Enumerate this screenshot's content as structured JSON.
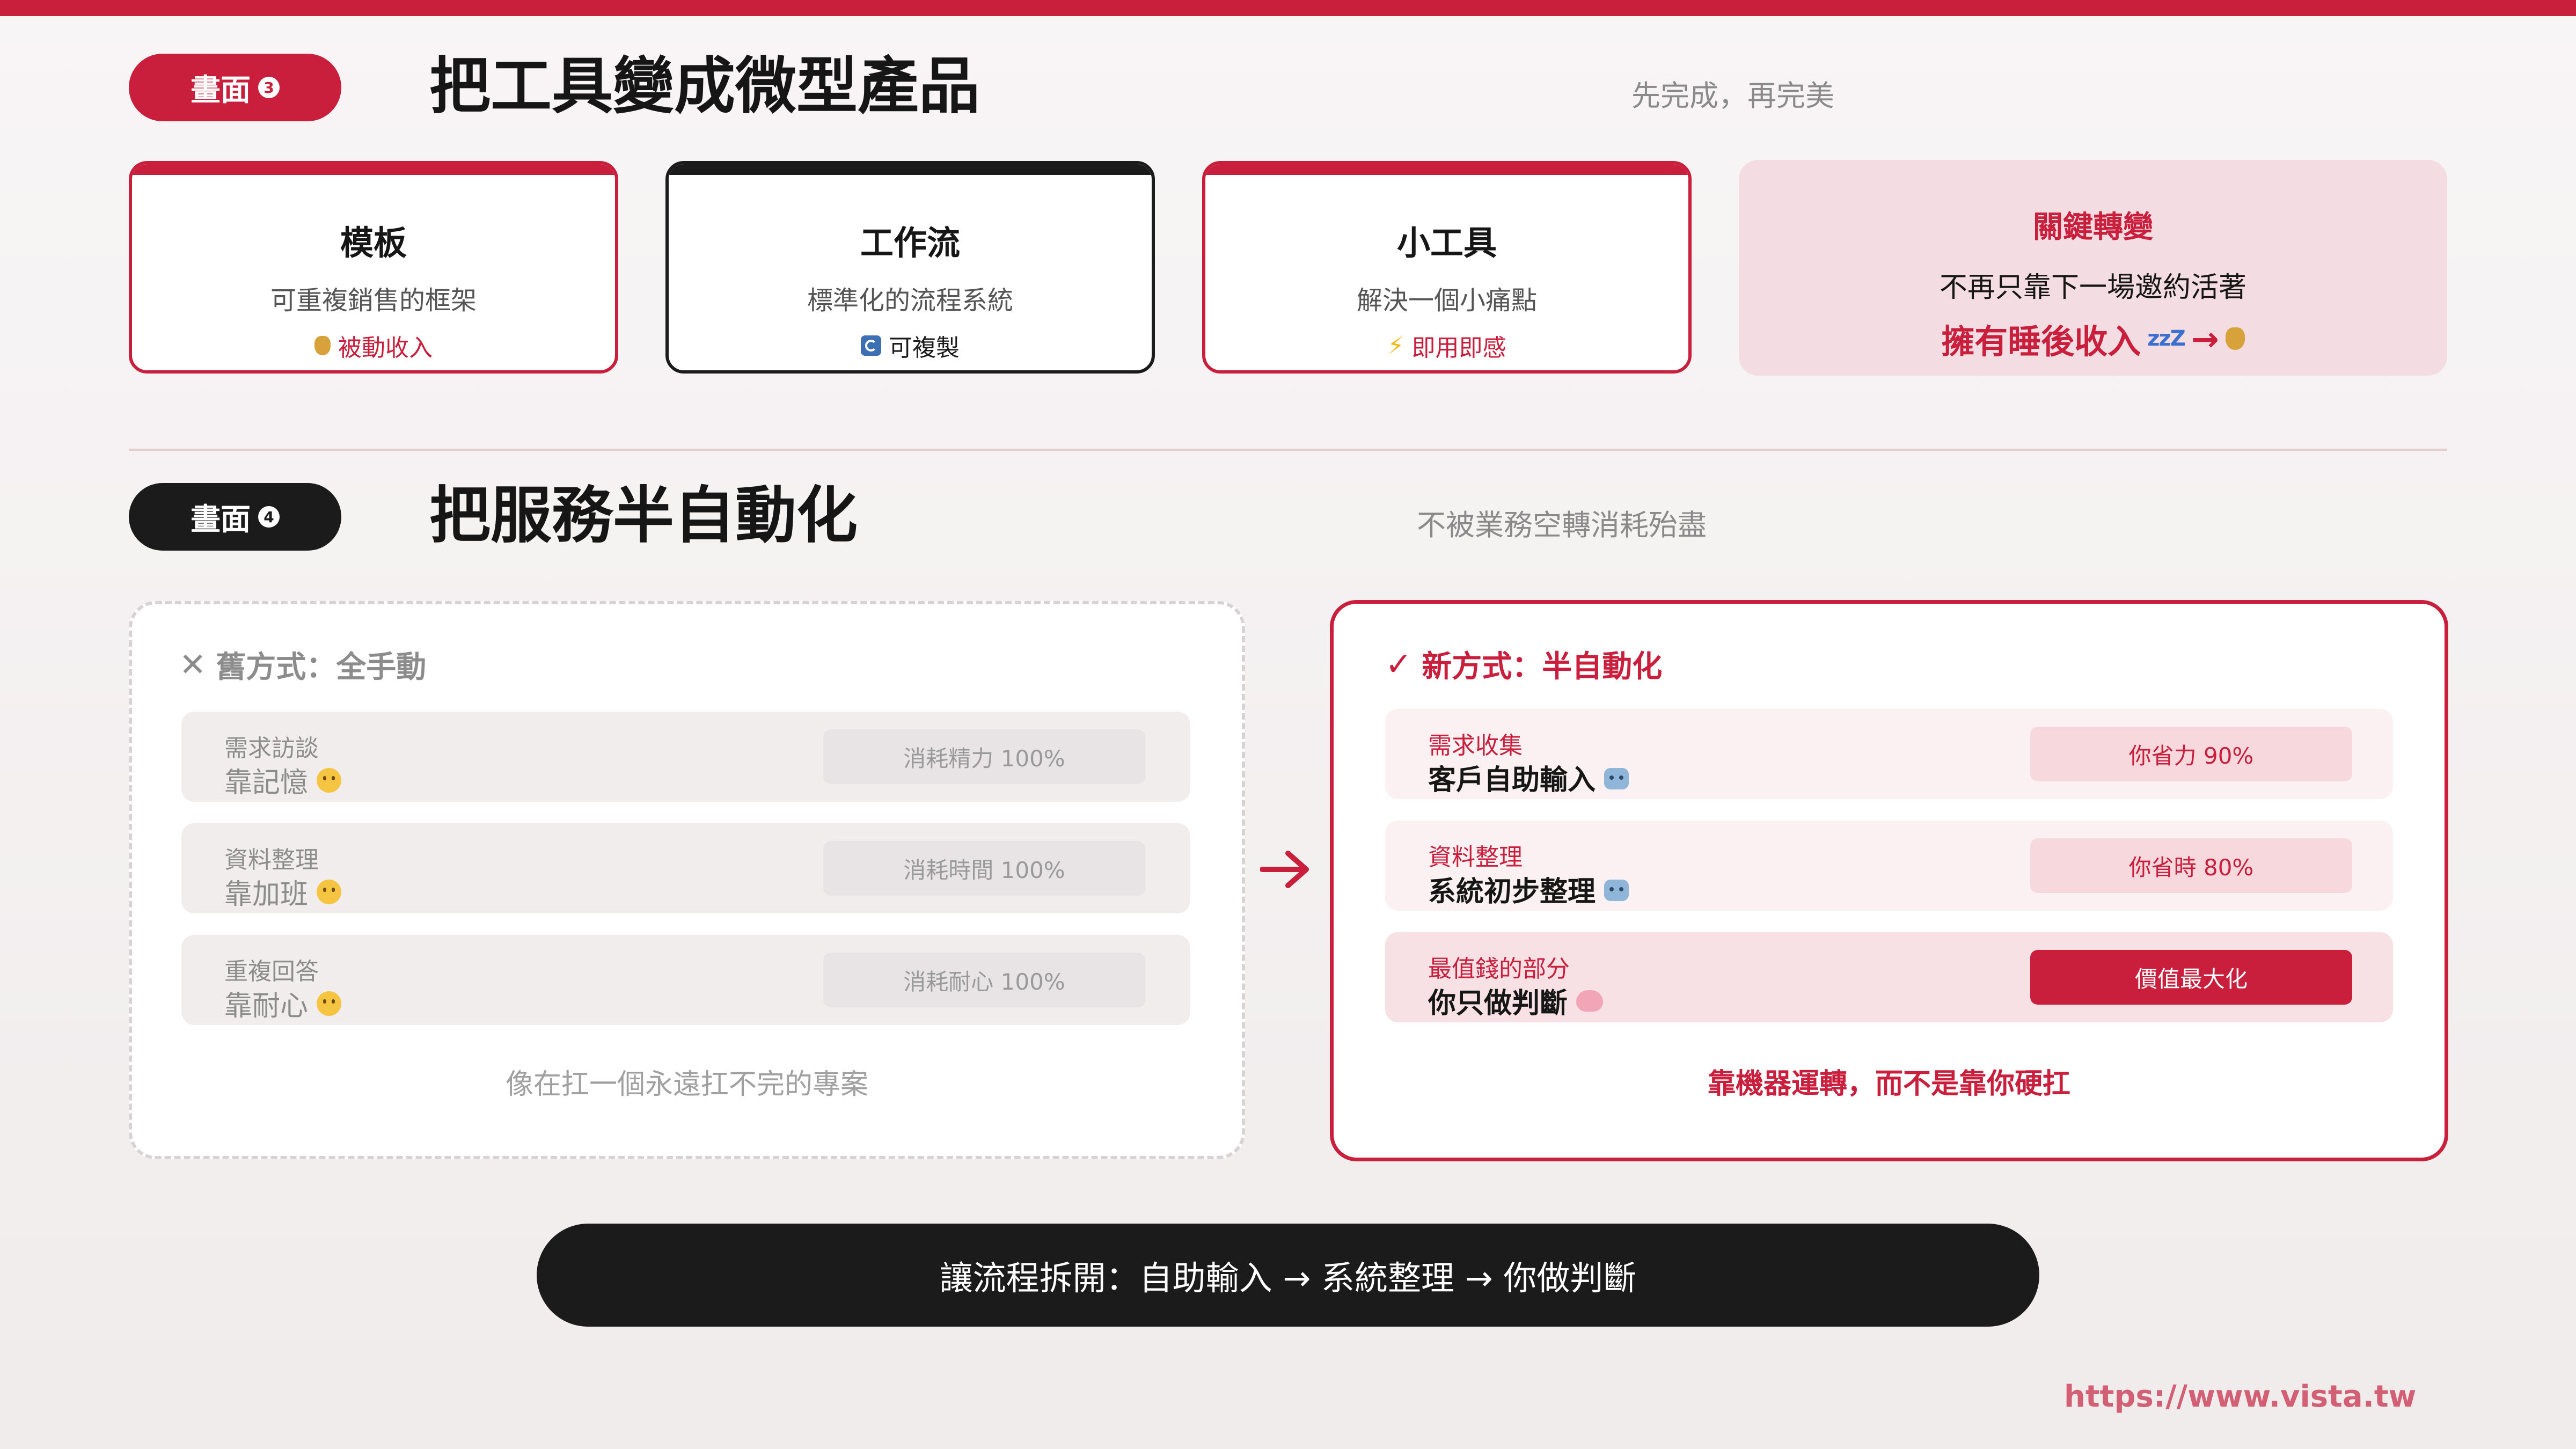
{
  "colors": {
    "accent": "#c91e3c",
    "dark": "#1b1b1b",
    "soft_pink": "#f3dde2"
  },
  "section3": {
    "badge": "畫面",
    "badge_num": "3",
    "title": "把工具變成微型產品",
    "subtitle": "先完成，再完美",
    "cards": [
      {
        "title": "模板",
        "desc": "可重複銷售的框架",
        "icon": "money-bag-icon",
        "tag": "被動收入"
      },
      {
        "title": "工作流",
        "desc": "標準化的流程系統",
        "icon": "cycle-icon",
        "tag": "可複製"
      },
      {
        "title": "小工具",
        "desc": "解決一個小痛點",
        "icon": "lightning-icon",
        "tag": "即用即感"
      }
    ],
    "key": {
      "title": "關鍵轉變",
      "line": "不再只靠下一場邀約活著",
      "highlight": "擁有睡後收入",
      "sleep_glyph": "zzZ",
      "arrow_glyph": "→"
    }
  },
  "section4": {
    "badge": "畫面",
    "badge_num": "4",
    "title": "把服務半自動化",
    "subtitle": "不被業務空轉消耗殆盡",
    "old": {
      "heading": "舊方式：全手動",
      "rows": [
        {
          "label": "需求訪談",
          "value": "靠記憶",
          "emoji": "astonished-face-icon",
          "chip": "消耗精力 100%"
        },
        {
          "label": "資料整理",
          "value": "靠加班",
          "emoji": "sweat-face-icon",
          "chip": "消耗時間 100%"
        },
        {
          "label": "重複回答",
          "value": "靠耐心",
          "emoji": "steam-face-icon",
          "chip": "消耗耐心 100%"
        }
      ],
      "footer": "像在扛一個永遠扛不完的專案"
    },
    "new": {
      "heading": "新方式：半自動化",
      "rows": [
        {
          "label": "需求收集",
          "value": "客戶自助輸入",
          "emoji": "robot-icon",
          "chip": "你省力 90%"
        },
        {
          "label": "資料整理",
          "value": "系統初步整理",
          "emoji": "robot-icon",
          "chip": "你省時 80%"
        },
        {
          "label": "最值錢的部分",
          "value": "你只做判斷",
          "emoji": "brain-icon",
          "chip": "價值最大化"
        }
      ],
      "footer": "靠機器運轉，而不是靠你硬扛"
    }
  },
  "bottom_bar": "讓流程拆開：自助輸入 → 系統整理 → 你做判斷",
  "url": "https://www.vista.tw"
}
